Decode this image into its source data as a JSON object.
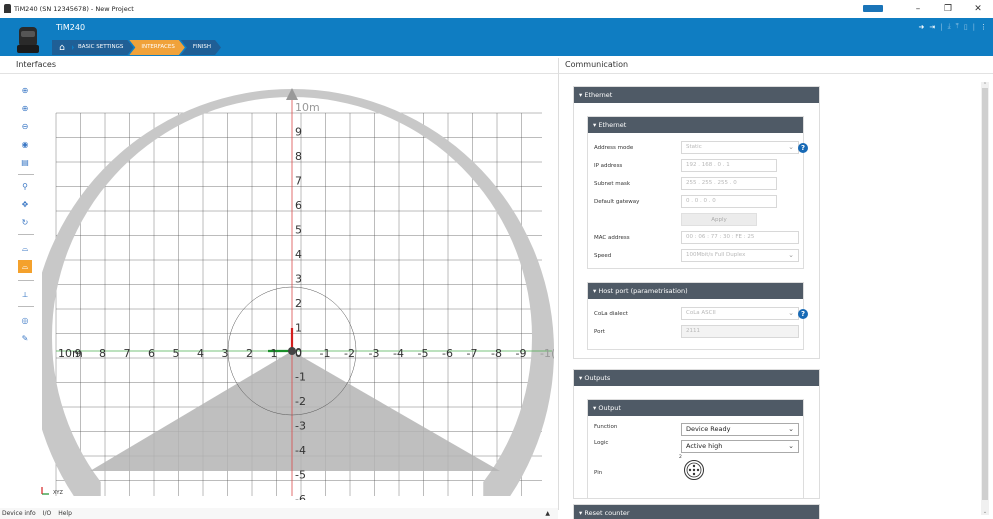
{
  "window": {
    "title": "TiM240 (SN 12345678) - New Project",
    "controls": [
      "–",
      "❐",
      "✕"
    ]
  },
  "header": {
    "app_name": "TiM240",
    "breadcrumbs": [
      {
        "label": "BASIC SETTINGS",
        "active": false
      },
      {
        "label": "INTERFACES",
        "active": true
      },
      {
        "label": "FINISH",
        "active": false
      }
    ]
  },
  "left": {
    "title": "Interfaces",
    "toolbar": [
      "zoom-in-icon",
      "zoom-in-fine-icon",
      "zoom-out-icon",
      "view-icon",
      "three-d-icon",
      "zoom-icon",
      "pan-icon",
      "rotate-icon",
      "field-icon",
      "field-edit-icon",
      "measure-icon",
      "visibility-icon",
      "wrench-icon"
    ],
    "chart": {
      "y_labels": [
        "10m",
        "9",
        "8",
        "7",
        "6",
        "5",
        "4",
        "3",
        "2",
        "1",
        "0",
        "-1",
        "-2",
        "-3",
        "-4",
        "-5",
        "-6"
      ],
      "x_labels": [
        "10m",
        "9",
        "8",
        "7",
        "6",
        "5",
        "4",
        "3",
        "2",
        "1",
        "0",
        "-1",
        "-2",
        "-3",
        "-4",
        "-5",
        "-6",
        "-7",
        "-8",
        "-9",
        "-1("
      ],
      "corner_label": "XYZ"
    },
    "statusbar": [
      "Device info",
      "I/O",
      "Help"
    ]
  },
  "right": {
    "title": "Communication",
    "ethernet_section": "Ethernet",
    "ethernet_sub": "Ethernet",
    "address_mode_label": "Address mode",
    "address_mode_value": "Static",
    "ip_label": "IP address",
    "ip_value": "192  .  168  .   0   .   1",
    "subnet_label": "Subnet mask",
    "subnet_value": "255  .  255  .  255  .   0",
    "gateway_label": "Default gateway",
    "gateway_value": "0   .   0   .   0   .   0",
    "apply_label": "Apply",
    "mac_label": "MAC address",
    "mac_value": "00  :  06  :  77  :  30  :  FE  :  25",
    "speed_label": "Speed",
    "speed_value": "100Mbit/s Full Duplex",
    "hostport_sub": "Host port (parametrisation)",
    "cola_label": "CoLa dialect",
    "cola_value": "CoLa ASCII",
    "port_label": "Port",
    "port_value": "2111",
    "outputs_section": "Outputs",
    "output_sub": "Output",
    "function_label": "Function",
    "function_value": "Device Ready",
    "logic_label": "Logic",
    "logic_value": "Active high",
    "pin_label": "Pin",
    "pin_number": "2",
    "reset_section": "Reset counter"
  },
  "colors": {
    "header_blue": "#0f7dc2",
    "accent_orange": "#f0a23a",
    "section_gray": "#4f5a66",
    "help_blue": "#1769b5"
  }
}
